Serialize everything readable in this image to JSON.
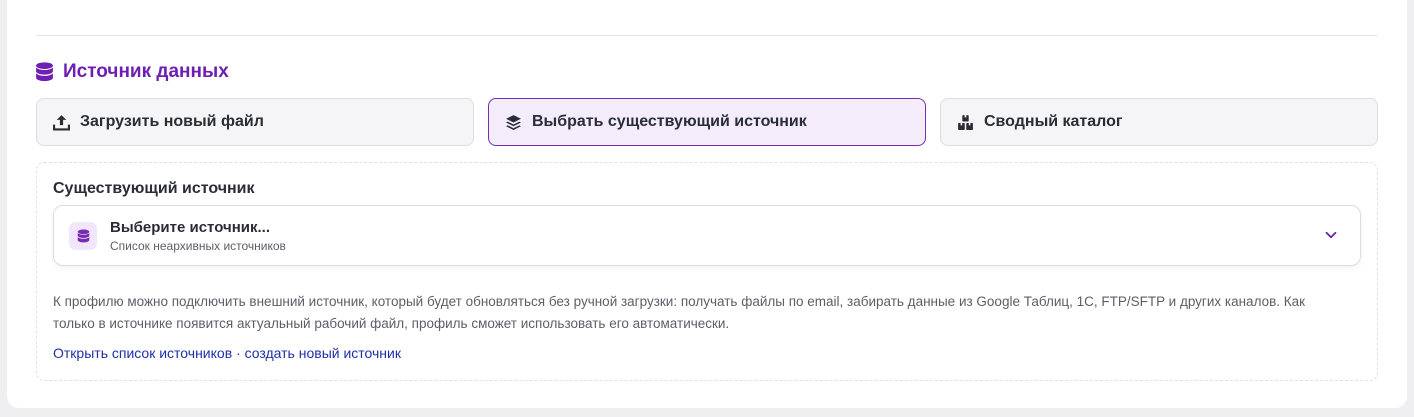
{
  "section": {
    "title": "Источник данных",
    "icon": "database-icon"
  },
  "tabs": [
    {
      "label": "Загрузить новый файл",
      "icon": "upload-icon",
      "active": false
    },
    {
      "label": "Выбрать существующий источник",
      "icon": "layers-icon",
      "active": true
    },
    {
      "label": "Сводный каталог",
      "icon": "boxes-icon",
      "active": false
    }
  ],
  "panel": {
    "label": "Существующий источник",
    "select": {
      "title": "Выберите источник...",
      "subtitle": "Список неархивных источников",
      "icon": "database-icon"
    },
    "hint": "К профилю можно подключить внешний источник, который будет обновляться без ручной загрузки: получать файлы по email, забирать данные из Google Таблиц, 1С, FTP/SFTP и других каналов. Как только в источнике появится актуальный рабочий файл, профиль сможет использовать его автоматически.",
    "links": {
      "open": "Открыть список источников",
      "separator": " · ",
      "create": "создать новый источник"
    }
  },
  "colors": {
    "accent": "#6d1fb3",
    "active_tab_bg": "#f4ecfb",
    "active_tab_border": "#7a2bb3",
    "link": "#1f2fa8"
  }
}
